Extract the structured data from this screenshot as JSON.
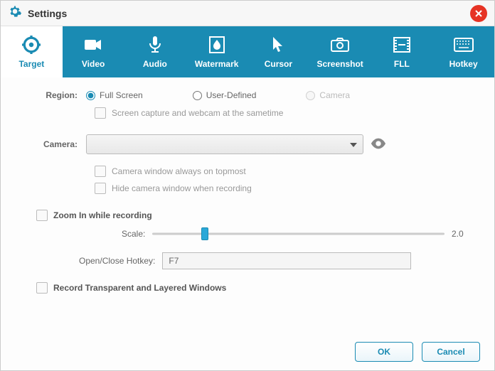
{
  "title": "Settings",
  "tabs": {
    "target": "Target",
    "video": "Video",
    "audio": "Audio",
    "watermark": "Watermark",
    "cursor": "Cursor",
    "screenshot": "Screenshot",
    "fll": "FLL",
    "hotkey": "Hotkey"
  },
  "region": {
    "label": "Region:",
    "full_screen": "Full Screen",
    "user_defined": "User-Defined",
    "camera": "Camera",
    "sametime": "Screen capture and webcam at the sametime"
  },
  "camera": {
    "label": "Camera:",
    "selected": "",
    "topmost": "Camera window always on topmost",
    "hide": "Hide camera window when recording"
  },
  "zoom": {
    "label": "Zoom In while recording",
    "scale_label": "Scale:",
    "scale_value": "2.0"
  },
  "hotkey_row": {
    "label": "Open/Close Hotkey:",
    "value": "F7"
  },
  "transparent": "Record Transparent and Layered Windows",
  "buttons": {
    "ok": "OK",
    "cancel": "Cancel"
  }
}
